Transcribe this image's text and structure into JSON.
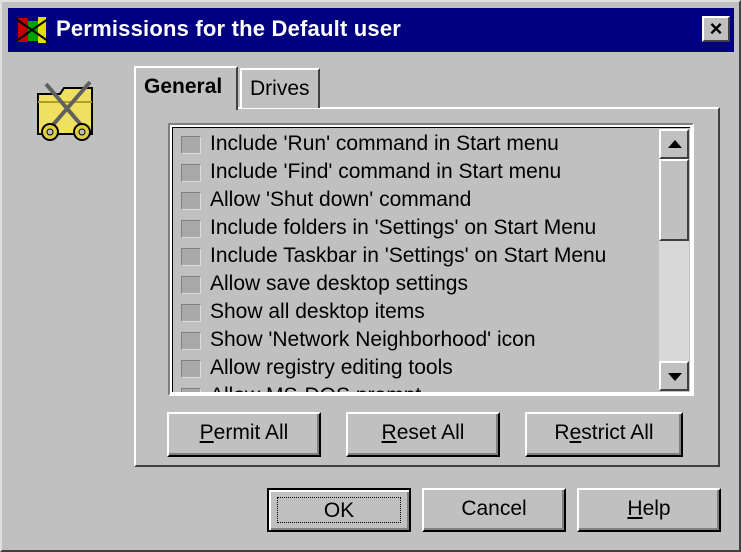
{
  "window": {
    "title": "Permissions for the Default user",
    "title_icon": "policy-editor-icon",
    "close_label": "×"
  },
  "dialog_icon": "security-keys-folder-icon",
  "tabs": [
    {
      "label": "General",
      "active": true
    },
    {
      "label": "Drives",
      "active": false
    }
  ],
  "permissions": [
    {
      "label": "Include 'Run' command in Start menu",
      "checked": false
    },
    {
      "label": "Include 'Find' command in Start menu",
      "checked": false
    },
    {
      "label": "Allow 'Shut down' command",
      "checked": false
    },
    {
      "label": "Include folders in 'Settings' on Start Menu",
      "checked": false
    },
    {
      "label": "Include Taskbar in 'Settings' on Start Menu",
      "checked": false
    },
    {
      "label": "Allow save desktop settings",
      "checked": false
    },
    {
      "label": "Show all desktop items",
      "checked": false
    },
    {
      "label": "Show 'Network Neighborhood' icon",
      "checked": false
    },
    {
      "label": "Allow registry editing tools",
      "checked": false
    },
    {
      "label": "Allow MS-DOS prompt",
      "checked": false
    }
  ],
  "buttons": {
    "permit_all": {
      "mnemonic": "P",
      "rest": "ermit All"
    },
    "reset_all": {
      "mnemonic": "R",
      "rest": "eset All"
    },
    "restrict_all": {
      "pre": "R",
      "mnemonic": "e",
      "rest": "strict All"
    },
    "ok": "OK",
    "cancel": "Cancel",
    "help": {
      "mnemonic": "H",
      "rest": "elp"
    }
  },
  "colors": {
    "titlebar": "#000080",
    "face": "#c0c0c0"
  }
}
